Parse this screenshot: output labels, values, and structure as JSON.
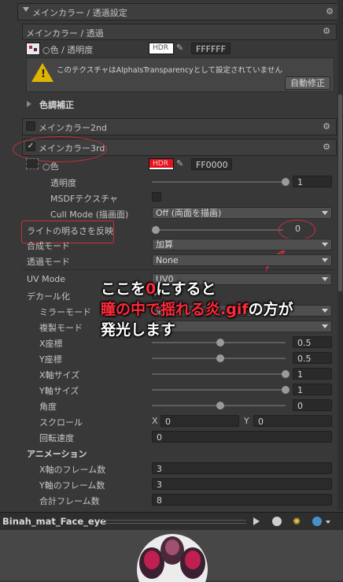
{
  "inspector": {
    "main_section_title": "メインカラー / 透過設定",
    "sub_section_title": "メインカラー / 透過",
    "color_label": "○色 / 透明度",
    "hdr_label": "HDR",
    "color_hex": "FFFFFF",
    "warning_text": "このテクスチャはAlphaIsTransparencyとして設定されていません",
    "fix_button": "自動修正",
    "color_correction": "色調補正",
    "main2_label": "メインカラー2nd",
    "main3_label": "メインカラー3rd",
    "main3_color_label": "○色",
    "main3_hdr_label": "HDR",
    "main3_color_hex": "FF0000",
    "opacity_label": "透明度",
    "opacity_value": "1",
    "msdf_label": "MSDFテクスチャ",
    "cull_label": "Cull Mode (描画面)",
    "cull_value": "Off (両面を描画)",
    "light_label": "ライトの明るさを反映",
    "light_value": "0",
    "blend_label": "合成モード",
    "blend_value": "加算",
    "transp_label": "透過モード",
    "transp_value": "None",
    "uv_label": "UV Mode",
    "uv_value": "UV0",
    "decal_label": "デカール化",
    "mirror_label": "ミラーモード",
    "mirror_value": "通常",
    "copy_label": "複製モード",
    "copy_value": "",
    "xpos_label": "X座標",
    "xpos_value": "0.5",
    "ypos_label": "Y座標",
    "ypos_value": "0.5",
    "xsize_label": "X軸サイズ",
    "xsize_value": "1",
    "ysize_label": "Y軸サイズ",
    "ysize_value": "1",
    "angle_label": "角度",
    "angle_value": "0",
    "scroll_label": "スクロール",
    "scroll_x_label": "X",
    "scroll_x_value": "0",
    "scroll_y_label": "Y",
    "scroll_y_value": "0",
    "rot_speed_label": "回転速度",
    "rot_speed_value": "0",
    "anim_header": "アニメーション",
    "xframes_label": "X軸のフレーム数",
    "xframes_value": "3",
    "yframes_label": "Y軸のフレーム数",
    "yframes_value": "3",
    "total_frames_label": "合計フレーム数",
    "total_frames_value": "8"
  },
  "preview": {
    "material_name": "Binah_mat_Face_eye"
  },
  "annotation": {
    "line1_pre": "ここを",
    "line1_zero": "0",
    "line1_post": "にすると",
    "line2_red": "瞳の中で揺れる炎.gif",
    "line2_post": "の方が",
    "line3": "発光します"
  },
  "colors": {
    "annotation_red": "#c8303f",
    "hdr_red": "#e3141f"
  }
}
